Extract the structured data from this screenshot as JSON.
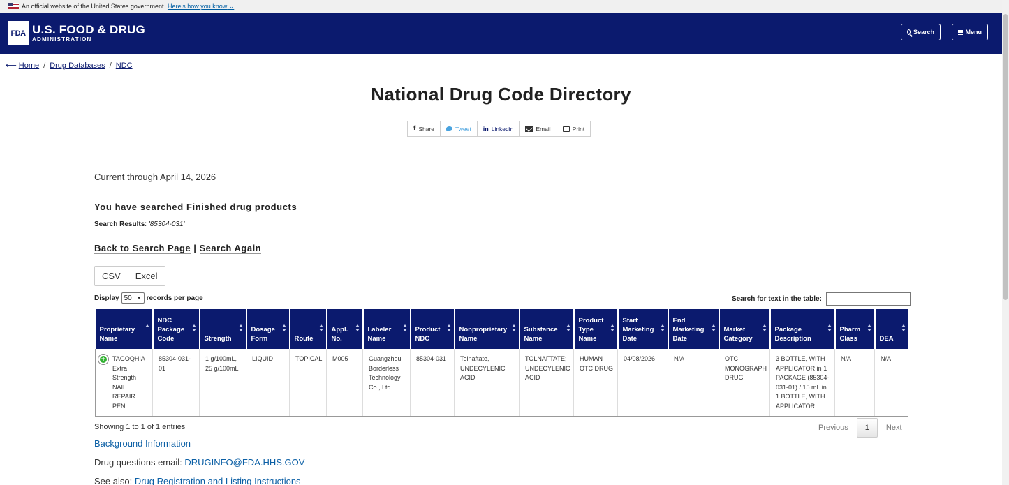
{
  "gov_banner": {
    "text": "An official website of the United States government",
    "link": "Here's how you know"
  },
  "header": {
    "logo_box": "FDA",
    "logo_line1": "U.S. FOOD & DRUG",
    "logo_line2": "ADMINISTRATION",
    "search_label": "Search",
    "menu_label": "Menu",
    "bg_color": "#0b1a6e"
  },
  "breadcrumb": [
    "Home",
    "Drug Databases",
    "NDC"
  ],
  "page_title": "National Drug Code Directory",
  "share": {
    "facebook": "Share",
    "twitter": "Tweet",
    "linkedin": "Linkedin",
    "email": "Email",
    "print": "Print"
  },
  "current_through": "Current through April 14, 2026",
  "searched_heading": "You have searched Finished drug products",
  "search_results": {
    "label": "Search Results",
    "query": "'85304-031'"
  },
  "nav_links": {
    "back": "Back to Search Page",
    "sep": "|",
    "again": "Search Again"
  },
  "exports": [
    "CSV",
    "Excel"
  ],
  "display": {
    "prefix": "Display",
    "value": "50",
    "suffix": "records per page"
  },
  "table_search_label": "Search for text in the table:",
  "table": {
    "columns": [
      "Proprietary Name",
      "NDC Package Code",
      "Strength",
      "Dosage Form",
      "Route",
      "Appl. No.",
      "Labeler Name",
      "Product NDC",
      "Nonproprietary Name",
      "Substance Name",
      "Product Type Name",
      "Start Marketing Date",
      "End Marketing Date",
      "Market Category",
      "Package Description",
      "Pharm Class",
      "DEA"
    ],
    "rows": [
      [
        "TAGOQHIA Extra Strength NAIL REPAIR PEN",
        "85304-031-01",
        "1 g/100mL, 25 g/100mL",
        "LIQUID",
        "TOPICAL",
        "M005",
        "Guangzhou Borderless Technology Co., Ltd.",
        "85304-031",
        "Tolnaftate, UNDECYLENIC ACID",
        "TOLNAFTATE; UNDECYLENIC ACID",
        "HUMAN OTC DRUG",
        "04/08/2026",
        "N/A",
        "OTC MONOGRAPH DRUG",
        "3 BOTTLE, WITH APPLICATOR in 1 PACKAGE (85304-031-01) / 15 mL in 1 BOTTLE, WITH APPLICATOR",
        "N/A",
        "N/A"
      ]
    ]
  },
  "showing": "Showing 1 to 1 of 1 entries",
  "pager": {
    "previous": "Previous",
    "current": "1",
    "next": "Next"
  },
  "background_info": "Background Information",
  "drug_questions": {
    "label": "Drug questions email: ",
    "email": "DRUGINFO@FDA.HHS.GOV"
  },
  "see_also": {
    "label": "See also: ",
    "link": "Drug Registration and Listing Instructions"
  }
}
